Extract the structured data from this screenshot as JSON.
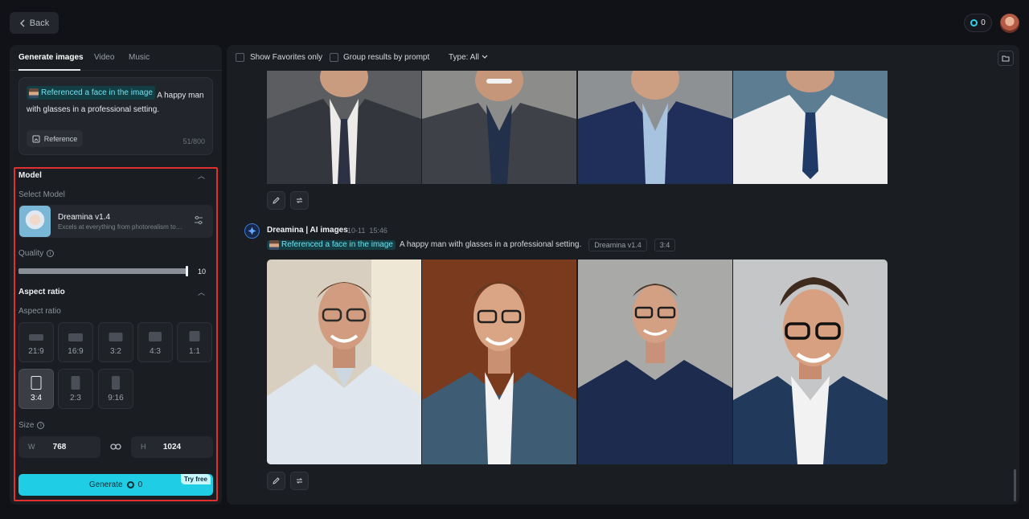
{
  "topbar": {
    "back_label": "Back",
    "credits": "0"
  },
  "left": {
    "tabs": [
      {
        "label": "Generate images"
      },
      {
        "label": "Video"
      },
      {
        "label": "Music"
      }
    ],
    "prompt": {
      "reference_chip": "Referenced a face in the image",
      "text": "A happy man with glasses in a professional setting.",
      "reference_button": "Reference",
      "counter": "51/800"
    },
    "model": {
      "section_title": "Model",
      "select_label": "Select Model",
      "name": "Dreamina v1.4",
      "description": "Excels at everything from photorealism to painterly style"
    },
    "quality": {
      "label": "Quality",
      "value": "10",
      "fraction": 1.0
    },
    "aspect": {
      "section_title": "Aspect ratio",
      "sub_label": "Aspect ratio",
      "options": [
        {
          "label": "21:9"
        },
        {
          "label": "16:9"
        },
        {
          "label": "3:2"
        },
        {
          "label": "4:3"
        },
        {
          "label": "1:1"
        },
        {
          "label": "3:4"
        },
        {
          "label": "2:3"
        },
        {
          "label": "9:16"
        }
      ],
      "selected": "3:4"
    },
    "size": {
      "label": "Size",
      "w_prefix": "W",
      "width": "768",
      "h_prefix": "H",
      "height": "1024"
    },
    "generate": {
      "label": "Generate",
      "cost": "0",
      "badge": "Try free"
    }
  },
  "right": {
    "filters": {
      "favorites": "Show Favorites only",
      "group": "Group results by prompt",
      "type": "Type: All"
    },
    "result": {
      "title": "Dreamina | AI images",
      "date": "10-11",
      "time": "15:46",
      "reference_chip": "Referenced a face in the image",
      "prompt": "A happy man with glasses in a professional setting.",
      "model_tag": "Dreamina v1.4",
      "ratio_tag": "3:4"
    }
  },
  "colors": {
    "accent": "#1fcde5",
    "highlight": "#e03030",
    "panel": "#1a1d22"
  }
}
